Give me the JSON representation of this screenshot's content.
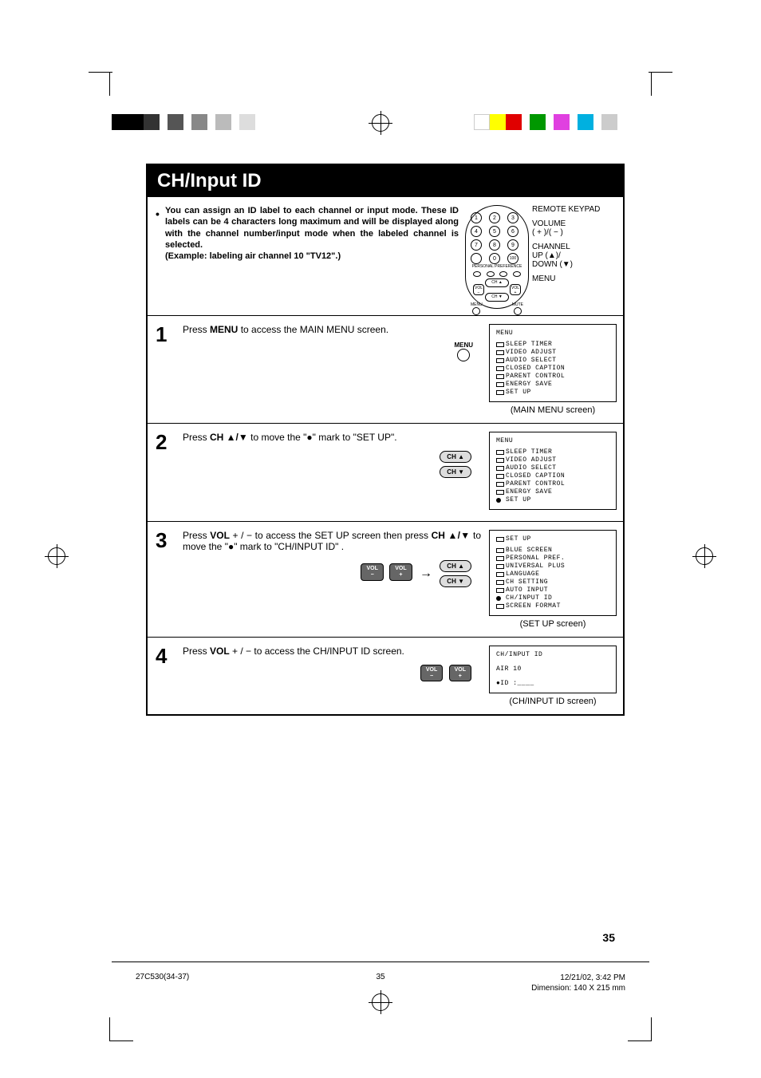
{
  "title": "CH/Input ID",
  "intro": {
    "text": "You can assign an ID label to each channel or input mode. These ID labels can be 4 characters long maximum and will be displayed along with the channel number/input mode when the labeled channel is selected.",
    "example": "(Example: labeling air channel 10 \"TV12\".)"
  },
  "remote_labels": {
    "keypad": "REMOTE KEYPAD",
    "volume": "VOLUME",
    "vol_symbols": "( + )/( − )",
    "channel": "CHANNEL",
    "ch_up": "UP (▲)/",
    "ch_down": "DOWN (▼)",
    "menu": "MENU"
  },
  "remote_buttons": {
    "pp": "PERSONAL PREFERENCE",
    "ch_up": "CH ▲",
    "ch_dn": "CH ▼",
    "vol_minus": "VOL −",
    "vol_plus": "VOL +",
    "menu": "MENU",
    "mute": "MUTE"
  },
  "steps": {
    "s1": {
      "num": "1",
      "text_a": "Press ",
      "text_b": "MENU",
      "text_c": " to access the MAIN MENU screen.",
      "btn_label": "MENU"
    },
    "s2": {
      "num": "2",
      "text_a": "Press ",
      "text_b": "CH ▲/▼",
      "text_c": " to move the \"●\" mark to \"SET UP\".",
      "ch_up": "CH ▲",
      "ch_dn": "CH ▼"
    },
    "s3": {
      "num": "3",
      "text_a": "Press ",
      "text_b": "VOL",
      "text_c": " + / −  to access the SET UP screen then press",
      "text_d": "CH ▲/▼",
      "text_e": " to move the \"●\" mark to \"CH/INPUT ID\" .",
      "vol_minus": "VOL\n−",
      "vol_plus": "VOL\n+",
      "ch_up": "CH ▲",
      "ch_dn": "CH ▼"
    },
    "s4": {
      "num": "4",
      "text_a": "Press ",
      "text_b": "VOL",
      "text_c": " + / −  to access the CH/INPUT ID screen.",
      "vol_minus": "VOL\n−",
      "vol_plus": "VOL\n+"
    }
  },
  "screens": {
    "main_menu": {
      "title": "MENU",
      "items": [
        "SLEEP TIMER",
        "VIDEO ADJUST",
        "AUDIO SELECT",
        "CLOSED CAPTION",
        "PARENT CONTROL",
        "ENERGY SAVE",
        "SET UP"
      ],
      "caption": "(MAIN MENU screen)"
    },
    "main_menu2": {
      "title": "MENU",
      "items": [
        "SLEEP TIMER",
        "VIDEO ADJUST",
        "AUDIO SELECT",
        "CLOSED CAPTION",
        "PARENT CONTROL",
        "ENERGY SAVE",
        "SET UP"
      ]
    },
    "setup": {
      "title": "SET UP",
      "items": [
        "BLUE SCREEN",
        "PERSONAL PREF.",
        "UNIVERSAL PLUS",
        "LANGUAGE",
        "CH SETTING",
        "AUTO INPUT",
        "CH/INPUT ID",
        "SCREEN FORMAT"
      ],
      "caption": "(SET UP screen)"
    },
    "chinput": {
      "title": "CH/INPUT ID",
      "line1": "AIR 10",
      "line2": "●ID :____",
      "caption": "(CH/INPUT ID screen)"
    }
  },
  "page_number": "35",
  "footer": {
    "left": "27C530(34-37)",
    "center": "35",
    "right_date": "12/21/02, 3:42 PM",
    "right_dim": "Dimension: 140  X 215 mm"
  }
}
